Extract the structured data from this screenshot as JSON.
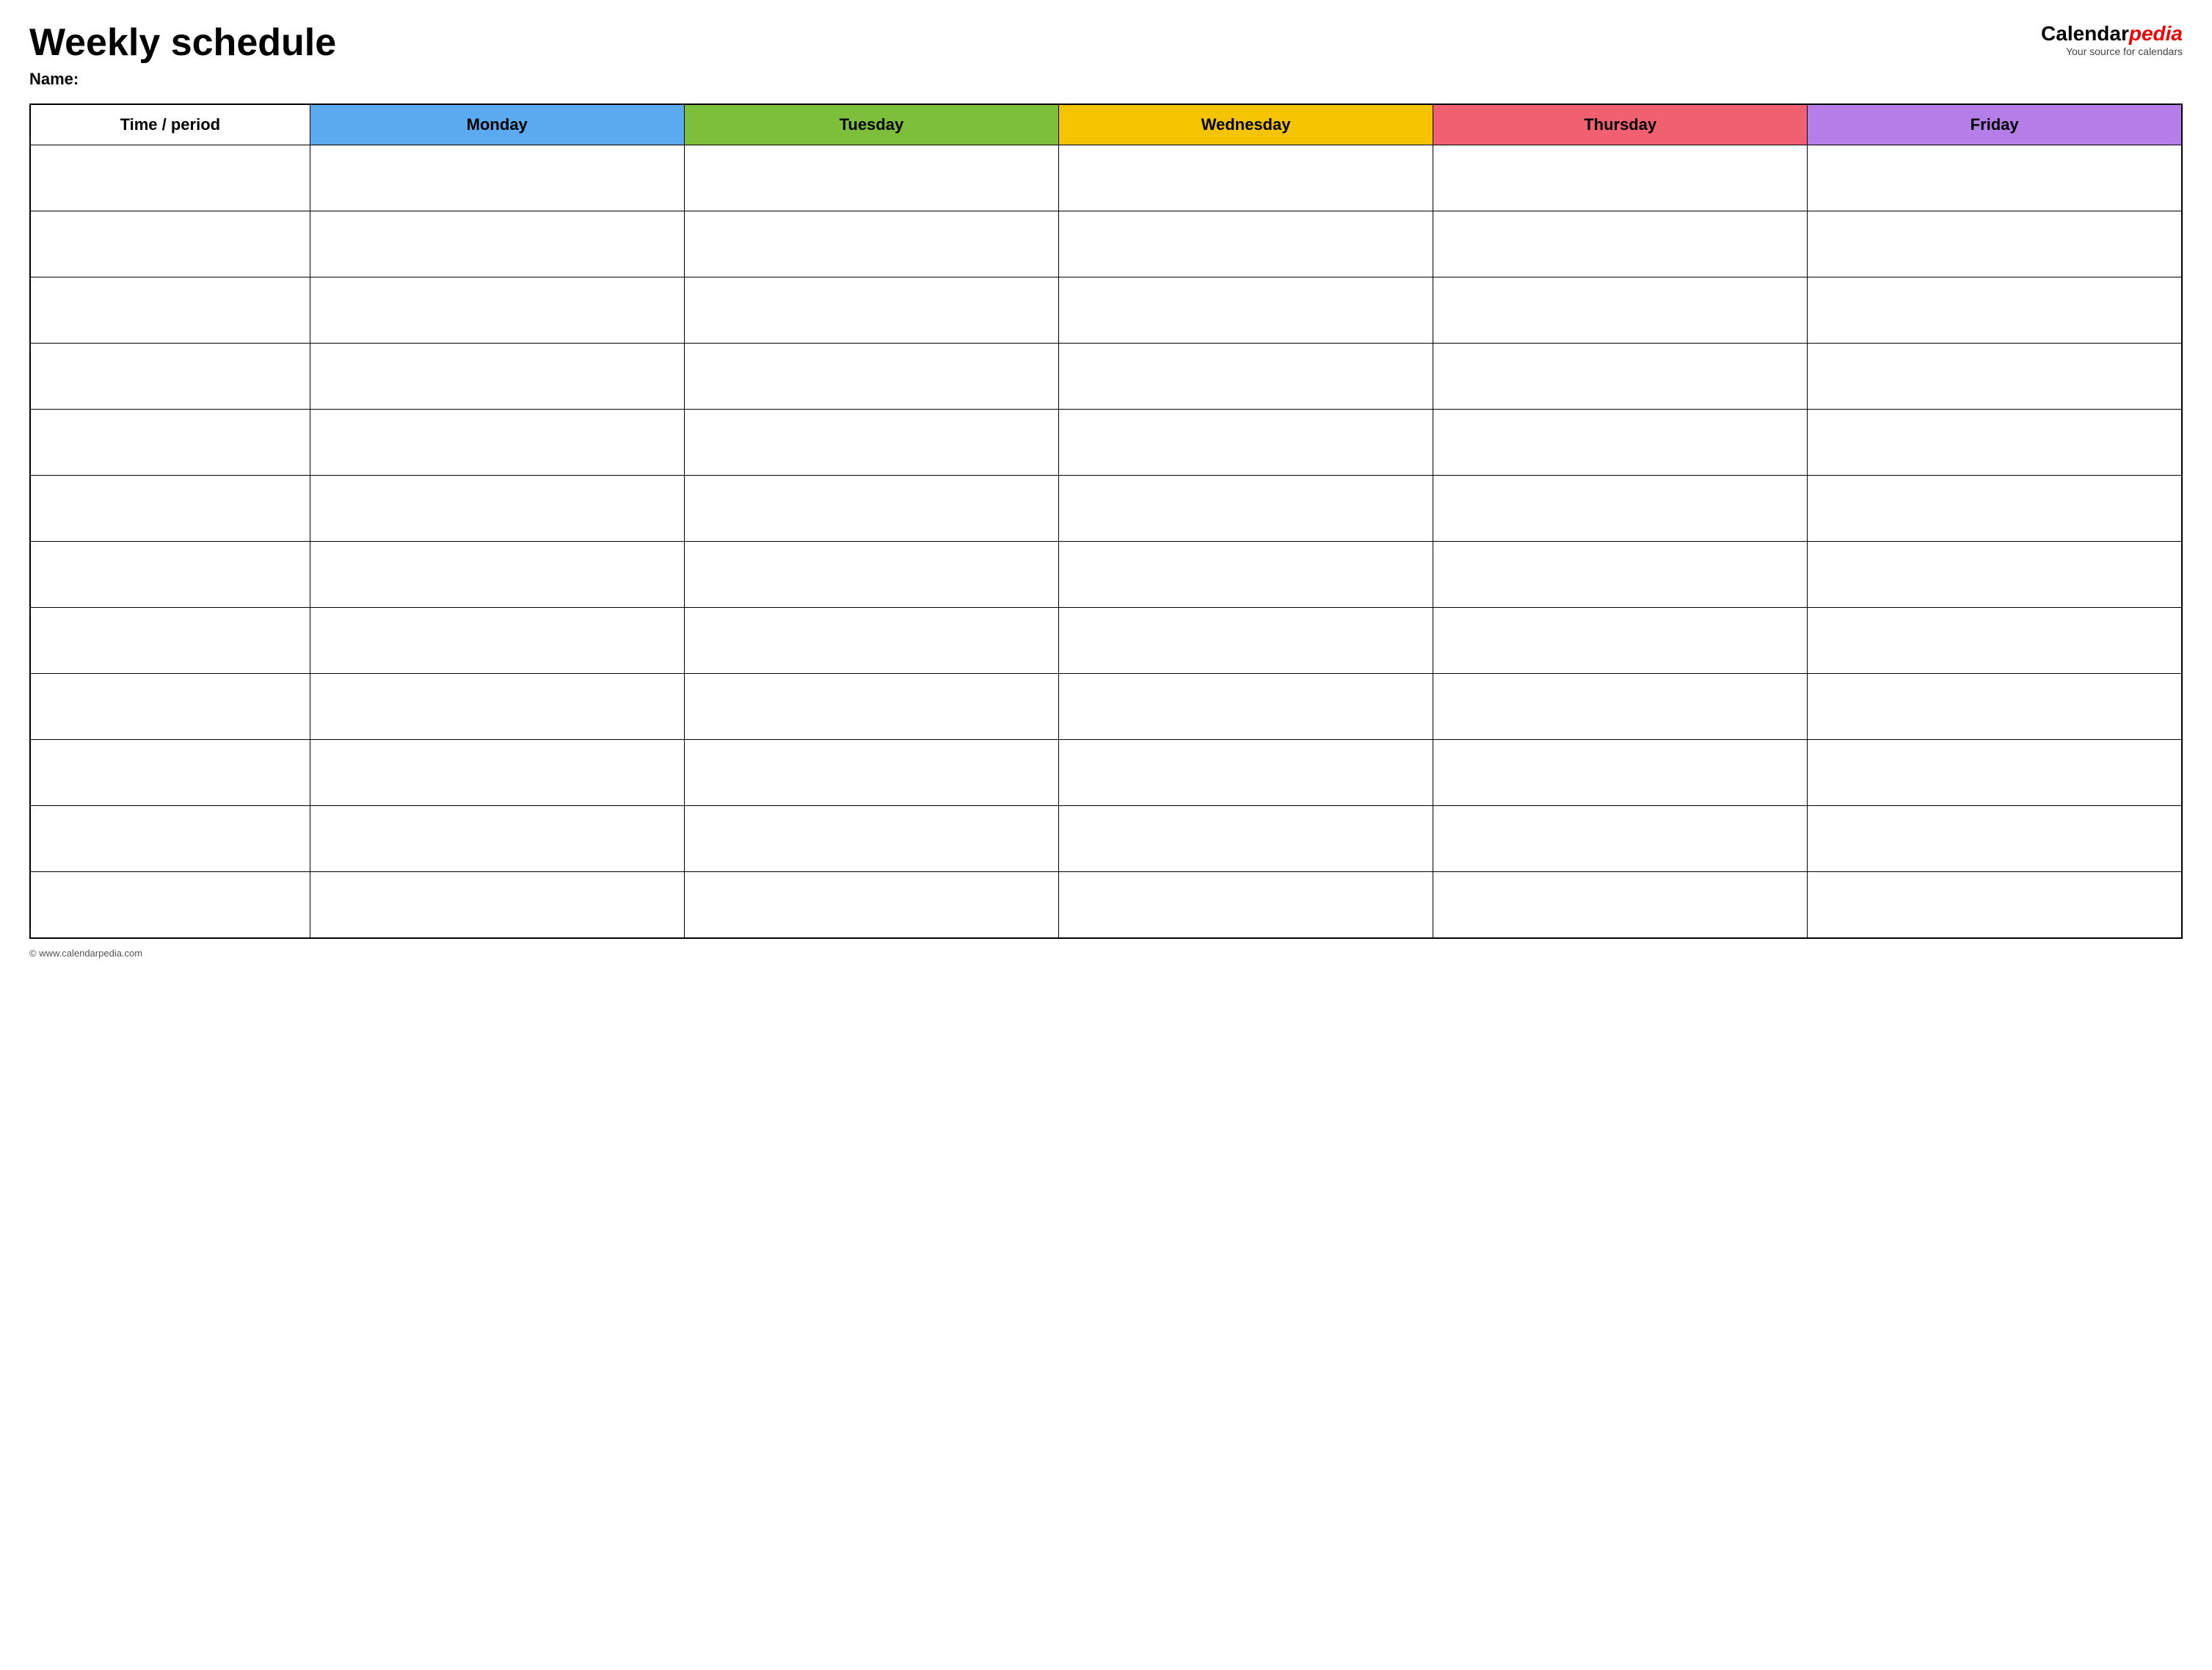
{
  "header": {
    "title": "Weekly schedule",
    "name_label": "Name:",
    "logo_calendar": "Calendar",
    "logo_pedia": "pedia",
    "logo_tagline": "Your source for calendars",
    "logo_url": "www.calendarpedia.com"
  },
  "table": {
    "columns": [
      {
        "key": "time",
        "label": "Time / period",
        "color": "#fff",
        "class": "col-time"
      },
      {
        "key": "monday",
        "label": "Monday",
        "color": "#5baaef",
        "class": "col-monday"
      },
      {
        "key": "tuesday",
        "label": "Tuesday",
        "color": "#7dbf3b",
        "class": "col-tuesday"
      },
      {
        "key": "wednesday",
        "label": "Wednesday",
        "color": "#f5c400",
        "class": "col-wednesday"
      },
      {
        "key": "thursday",
        "label": "Thursday",
        "color": "#f06070",
        "class": "col-thursday"
      },
      {
        "key": "friday",
        "label": "Friday",
        "color": "#b57de8",
        "class": "col-friday"
      }
    ],
    "row_count": 12
  },
  "footer": {
    "url": "© www.calendarpedia.com"
  }
}
